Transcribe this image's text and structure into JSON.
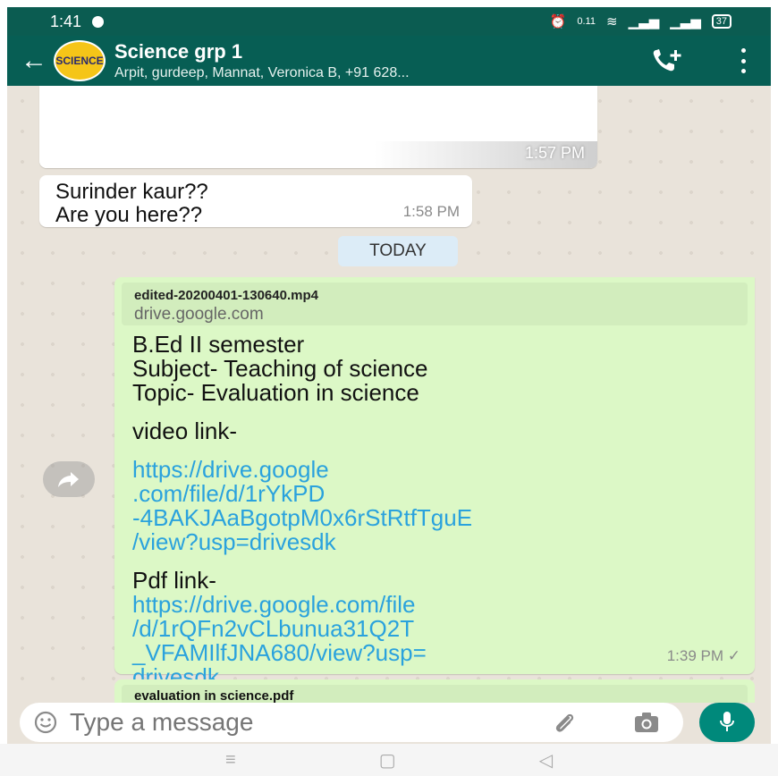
{
  "status_bar": {
    "time": "1:41",
    "network_speed": "0.11",
    "battery": "37"
  },
  "header": {
    "avatar_text": "SCIENCE",
    "group_name": "Science grp 1",
    "members": "Arpit, gurdeep, Mannat, Veronica B, +91 628..."
  },
  "messages": {
    "blurred_time": "1:57 PM",
    "surinder": {
      "line1": "Surinder kaur??",
      "line2": "Are you here??",
      "time": "1:58 PM"
    },
    "date_chip": "TODAY",
    "outgoing": {
      "preview_file": "edited-20200401-130640.mp4",
      "preview_domain": "drive.google.com",
      "line1": "B.Ed II semester",
      "line2": "Subject- Teaching of science",
      "line3": "Topic- Evaluation in science",
      "video_label": "video link-",
      "video_link_1": "https://drive.google",
      "video_link_2": ".com/file/d/1rYkPD",
      "video_link_3": "-4BAKJAaBgotpM0x6rStRtfTguE",
      "video_link_4": "/view?usp=drivesdk",
      "pdf_label": "Pdf link-",
      "pdf_link_1": "https://drive.google.com/file",
      "pdf_link_2": "/d/1rQFn2vCLbunua31Q2T",
      "pdf_link_3": "_VFAMIlfJNA680/view?usp=",
      "pdf_link_4": "drivesdk",
      "time": "1:39 PM ✓"
    },
    "next_preview_file": "evaluation in science.pdf"
  },
  "input": {
    "placeholder": "Type a message"
  },
  "colors": {
    "header": "#075e54",
    "outgoing_bubble": "#dcf8c6",
    "link": "#2aa2dd",
    "mic": "#00897b"
  }
}
